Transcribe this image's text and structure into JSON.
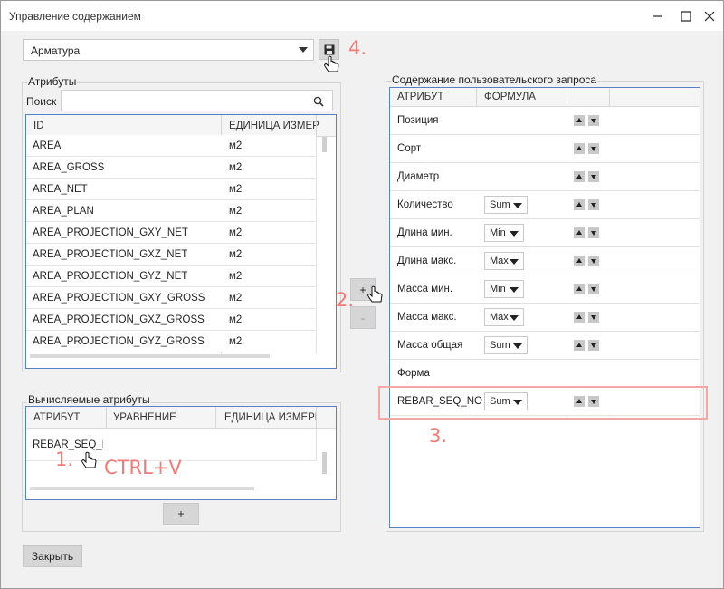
{
  "window": {
    "title": "Управление содержанием"
  },
  "toolbar": {
    "combo_value": "Арматура",
    "step4": "4."
  },
  "attributes": {
    "group_title": "Атрибуты",
    "search_label": "Поиск",
    "search_value": "",
    "columns": [
      "ID",
      "ЕДИНИЦА ИЗМЕРЕ"
    ],
    "rows": [
      [
        "AREA",
        "м2"
      ],
      [
        "AREA_GROSS",
        "м2"
      ],
      [
        "AREA_NET",
        "м2"
      ],
      [
        "AREA_PLAN",
        "м2"
      ],
      [
        "AREA_PROJECTION_GXY_NET",
        "м2"
      ],
      [
        "AREA_PROJECTION_GXZ_NET",
        "м2"
      ],
      [
        "AREA_PROJECTION_GYZ_NET",
        "м2"
      ],
      [
        "AREA_PROJECTION_GXY_GROSS",
        "м2"
      ],
      [
        "AREA_PROJECTION_GXZ_GROSS",
        "м2"
      ],
      [
        "AREA_PROJECTION_GYZ_GROSS",
        "м2"
      ]
    ]
  },
  "middle": {
    "add_label": "+",
    "remove_label": "-",
    "step2": "2."
  },
  "computed": {
    "group_title": "Вычисляемые атрибуты",
    "columns": [
      "АТРИБУТ",
      "УРАВНЕНИЕ",
      "ЕДИНИЦА ИЗМЕРЕ"
    ],
    "row": [
      "REBAR_SEQ_NO",
      "",
      ""
    ],
    "step1": "1.",
    "hint": "CTRL+V",
    "add_label": "+"
  },
  "query": {
    "group_title": "Содержание пользовательского запроса",
    "columns": [
      "АТРИБУТ",
      "ФОРМУЛА"
    ],
    "rows": [
      {
        "label": "Позиция",
        "agg": ""
      },
      {
        "label": "Сорт",
        "agg": ""
      },
      {
        "label": "Диаметр",
        "agg": ""
      },
      {
        "label": "Количество",
        "agg": "Sum"
      },
      {
        "label": "Длина мин.",
        "agg": "Min"
      },
      {
        "label": "Длина макс.",
        "agg": "Max"
      },
      {
        "label": "Масса мин.",
        "agg": "Min"
      },
      {
        "label": "Масса макс.",
        "agg": "Max"
      },
      {
        "label": "Масса общая",
        "agg": "Sum"
      },
      {
        "label": "Форма",
        "agg": ""
      },
      {
        "label": "REBAR_SEQ_NO",
        "agg": "Sum"
      }
    ],
    "step3": "3."
  },
  "footer": {
    "close_label": "Закрыть"
  },
  "colors": {
    "annotation": "#f07a78",
    "grid_border": "#5b7ec9"
  }
}
